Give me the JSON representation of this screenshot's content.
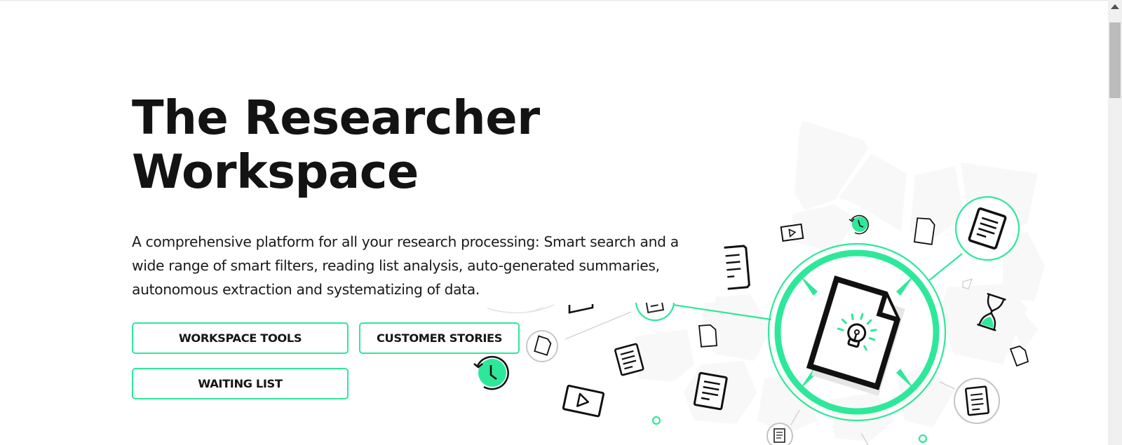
{
  "hero": {
    "title_line1": "The Researcher",
    "title_line2": "Workspace",
    "description": "A comprehensive platform for all your research processing: Smart search and a wide range of smart filters, reading list analysis, auto-generated summaries, autonomous extraction and systematizing of data."
  },
  "buttons": {
    "workspace_tools": "WORKSPACE TOOLS",
    "customer_stories": "CUSTOMER STORIES",
    "waiting_list": "WAITING LIST"
  },
  "colors": {
    "accent": "#2ee89a",
    "text": "#131313",
    "background": "#ffffff",
    "illustration_bg": "#f8f8f8"
  },
  "illustration": {
    "center_icon": "document-lightbulb-icon",
    "surrounding_icons": [
      "document-lines-icon",
      "document-icon",
      "video-play-icon",
      "clock-history-icon",
      "hourglass-icon"
    ]
  }
}
